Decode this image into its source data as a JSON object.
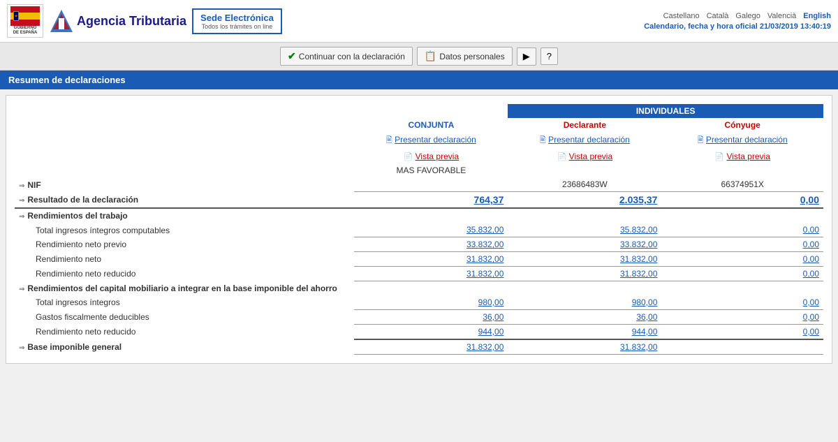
{
  "header": {
    "gov": {
      "line1": "GOBIERNO",
      "line2": "DE ESPAÑA"
    },
    "agency": "Agencia Tributaria",
    "sede": {
      "title": "Sede Electrónica",
      "subtitle": "Todos los trámites on line"
    },
    "languages": [
      "Castellano",
      "Català",
      "Galego",
      "Valencià",
      "English"
    ],
    "active_language": "English",
    "date_label": "Calendario, fecha y hora oficial 21/03/2019 13:40:19"
  },
  "toolbar": {
    "btn_continuar": "Continuar con la declaración",
    "btn_datos": "Datos personales",
    "btn_video": "▶",
    "btn_help": "?"
  },
  "section_title": "Resumen de declaraciones",
  "table": {
    "col_individuales": "INDIVIDUALES",
    "col_conjunta": "CONJUNTA",
    "col_declarante": "Declarante",
    "col_conyuge": "Cónyuge",
    "link_presentar": "Presentar declaración",
    "link_vista": "Vista previa",
    "mas_favorable": "MAS FAVORABLE",
    "nif_declarante": "23686483W",
    "nif_conyuge": "66374951X",
    "rows": [
      {
        "label": "NIF",
        "bold": true,
        "arrow": true,
        "conjunta": "",
        "declarante": "23686483W",
        "conyuge": "66374951X",
        "type": "nif"
      },
      {
        "label": "Resultado de la declaración",
        "bold": true,
        "arrow": true,
        "conjunta": "764,37",
        "declarante": "2.035,37",
        "conyuge": "0,00",
        "type": "result"
      },
      {
        "label": "Rendimientos del trabajo",
        "bold": true,
        "arrow": true,
        "conjunta": "",
        "declarante": "",
        "conyuge": "",
        "type": "header"
      },
      {
        "label": "Total ingresos íntegros computables",
        "bold": false,
        "arrow": false,
        "indent": true,
        "conjunta": "35.832,00",
        "declarante": "35.832,00",
        "conyuge": "0,00",
        "type": "data"
      },
      {
        "label": "Rendimiento neto previo",
        "bold": false,
        "arrow": false,
        "indent": true,
        "conjunta": "33.832,00",
        "declarante": "33.832,00",
        "conyuge": "0,00",
        "type": "data"
      },
      {
        "label": "Rendimiento neto",
        "bold": false,
        "arrow": false,
        "indent": true,
        "conjunta": "31.832,00",
        "declarante": "31.832,00",
        "conyuge": "0,00",
        "type": "data"
      },
      {
        "label": "Rendimiento neto reducido",
        "bold": false,
        "arrow": false,
        "indent": true,
        "conjunta": "31.832,00",
        "declarante": "31.832,00",
        "conyuge": "0,00",
        "type": "data"
      },
      {
        "label": "Rendimientos del capital mobiliario a integrar en la base imponible del ahorro",
        "bold": true,
        "arrow": true,
        "conjunta": "",
        "declarante": "",
        "conyuge": "",
        "type": "header"
      },
      {
        "label": "Total ingresos íntegros",
        "bold": false,
        "arrow": false,
        "indent": true,
        "conjunta": "980,00",
        "declarante": "980,00",
        "conyuge": "0,00",
        "type": "data"
      },
      {
        "label": "Gastos fiscalmente deducibles",
        "bold": false,
        "arrow": false,
        "indent": true,
        "conjunta": "36,00",
        "declarante": "36,00",
        "conyuge": "0,00",
        "type": "data"
      },
      {
        "label": "Rendimiento neto reducido",
        "bold": false,
        "arrow": false,
        "indent": true,
        "conjunta": "944,00",
        "declarante": "944,00",
        "conyuge": "0,00",
        "type": "data"
      },
      {
        "label": "Base imponible general",
        "bold": true,
        "arrow": true,
        "conjunta": "31.832,00",
        "declarante": "31.832,00",
        "conyuge": "",
        "type": "bottom-header"
      }
    ]
  }
}
